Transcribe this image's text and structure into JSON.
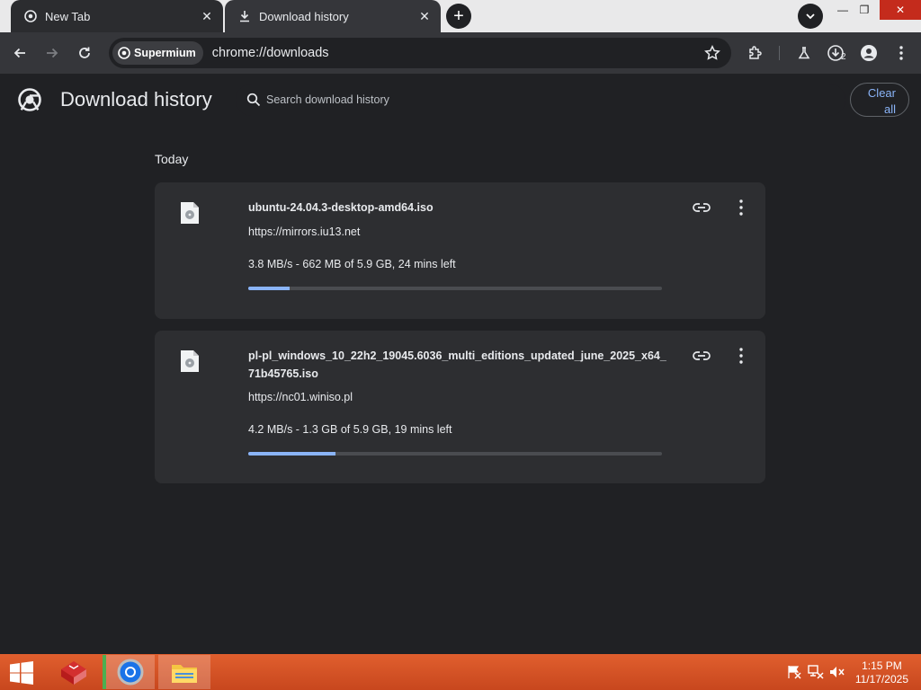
{
  "browser": {
    "tabs": [
      {
        "label": "New Tab"
      },
      {
        "label": "Download history"
      }
    ],
    "chip_label": "Supermium",
    "url": "chrome://downloads",
    "downloads_badge": "2"
  },
  "page": {
    "title": "Download history",
    "search_placeholder": "Search download history",
    "clear_all_line1": "Clear",
    "clear_all_line2": "all",
    "section_label": "Today",
    "downloads": [
      {
        "filename": "ubuntu-24.04.3-desktop-amd64.iso",
        "source": "https://mirrors.iu13.net",
        "status": "3.8 MB/s - 662 MB of 5.9 GB, 24 mins left",
        "progress_percent": 10
      },
      {
        "filename": "pl-pl_windows_10_22h2_19045.6036_multi_editions_updated_june_2025_x64_71b45765.iso",
        "source": "https://nc01.winiso.pl",
        "status": "4.2 MB/s - 1.3 GB of 5.9 GB, 19 mins left",
        "progress_percent": 21
      }
    ]
  },
  "taskbar": {
    "time": "1:15 PM",
    "date": "11/17/2025"
  },
  "colors": {
    "accent": "#8ab4f8",
    "page_bg": "#202124",
    "card_bg": "#2d2e31",
    "taskbar": "#d4542a"
  }
}
